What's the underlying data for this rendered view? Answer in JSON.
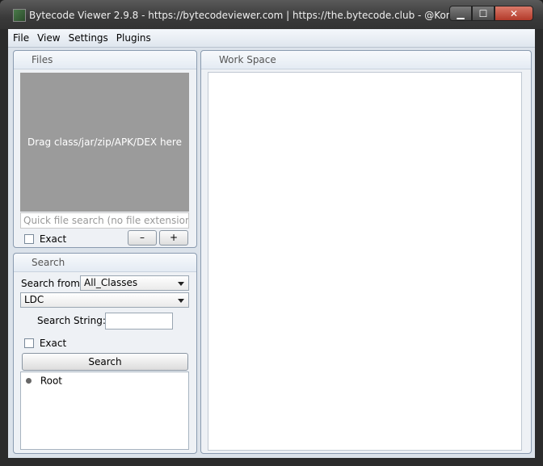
{
  "window": {
    "title": "Bytecode Viewer 2.9.8 - https://bytecodeviewer.com | https://the.bytecode.club - @Konloch",
    "icon": "bytecode-viewer-app-icon",
    "controls": {
      "minimize": "▁",
      "maximize": "☐",
      "close": "✕"
    }
  },
  "menubar": {
    "items": [
      "File",
      "View",
      "Settings",
      "Plugins"
    ]
  },
  "files_panel": {
    "title": "Files",
    "dropzone_text": "Drag class/jar/zip/APK/DEX here",
    "search_placeholder": "Quick file search (no file extension)",
    "exact_label": "Exact",
    "minus_label": "–",
    "plus_label": "+"
  },
  "search_panel": {
    "title": "Search",
    "search_from_label": "Search from",
    "search_from_value": "All_Classes",
    "type_value": "LDC",
    "search_string_label": "Search String:",
    "search_string_value": "",
    "exact_label": "Exact",
    "search_button": "Search",
    "tree_root": "Root"
  },
  "workspace": {
    "title": "Work Space"
  }
}
